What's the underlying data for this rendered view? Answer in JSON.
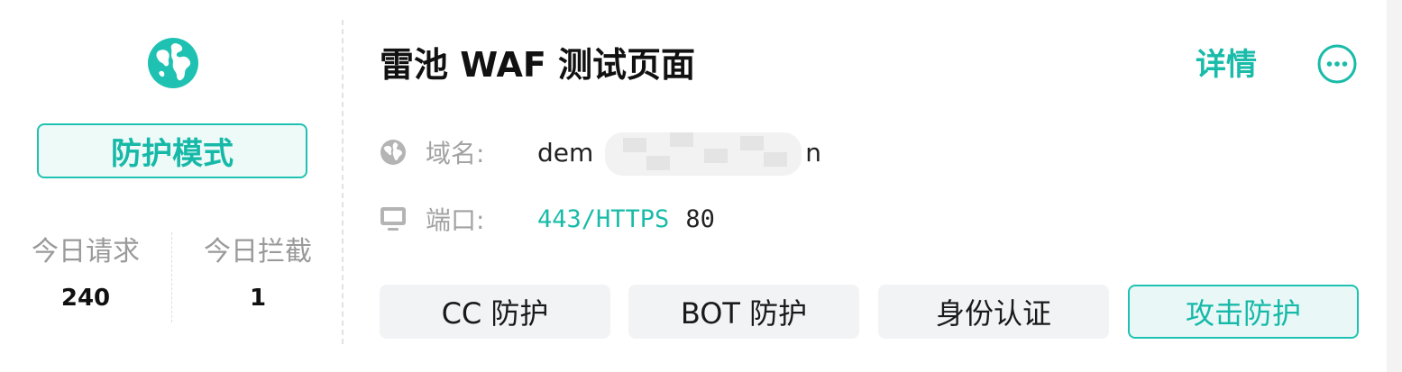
{
  "app": {
    "title": "雷池 WAF 测试页面",
    "accent_color": "#19bba9"
  },
  "left_panel": {
    "logo_icon": "globe-icon",
    "mode_label": "防护模式",
    "stats": {
      "requests_label": "今日请求",
      "requests_value": "240",
      "blocked_label": "今日拦截",
      "blocked_value": "1"
    }
  },
  "header": {
    "details_label": "详情",
    "more_icon": "more-ellipsis-icon"
  },
  "info": {
    "domain_label": "域名:",
    "domain_value": "dem",
    "domain_tail": "n",
    "port_label": "端口:",
    "port_primary": "443/HTTPS",
    "port_secondary": "80"
  },
  "features": {
    "cc": "CC 防护",
    "bot": "BOT 防护",
    "auth": "身份认证",
    "attack": "攻击防护"
  }
}
